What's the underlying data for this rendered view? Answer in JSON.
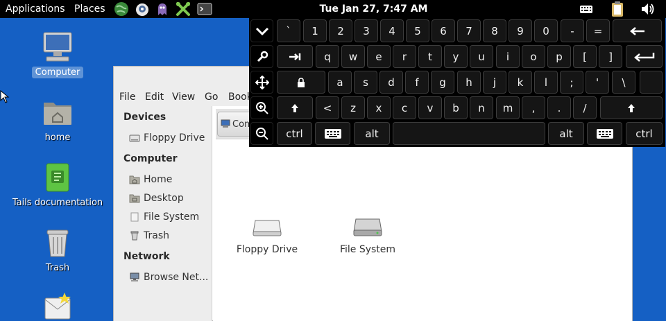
{
  "top_panel": {
    "applications": "Applications",
    "places": "Places",
    "clock": "Tue Jan 27,  7:47 AM"
  },
  "desktop": {
    "icons": [
      {
        "label": "Computer",
        "icon": "computer-icon"
      },
      {
        "label": "home",
        "icon": "home-folder-icon"
      },
      {
        "label": "Tails documentation",
        "icon": "documentation-icon"
      },
      {
        "label": "Trash",
        "icon": "trash-icon"
      },
      {
        "label": "",
        "icon": "mail-icon"
      }
    ]
  },
  "file_manager": {
    "menu": [
      "File",
      "Edit",
      "View",
      "Go",
      "Book"
    ],
    "sidebar": {
      "devices_heading": "Devices",
      "devices": [
        "Floppy Drive"
      ],
      "computer_heading": "Computer",
      "computer": [
        "Home",
        "Desktop",
        "File System",
        "Trash"
      ],
      "network_heading": "Network",
      "network": [
        "Browse Net..."
      ]
    },
    "location_button": "Com",
    "items": [
      "Floppy Drive",
      "File System"
    ]
  },
  "keyboard": {
    "rows": [
      [
        "collapse",
        "`",
        "1",
        "2",
        "3",
        "4",
        "5",
        "6",
        "7",
        "8",
        "9",
        "0",
        "-",
        "=",
        "backspace"
      ],
      [
        "settings",
        "tab",
        "q",
        "w",
        "e",
        "r",
        "t",
        "y",
        "u",
        "i",
        "o",
        "p",
        "[",
        "]",
        "enter"
      ],
      [
        "move",
        "caps-lock",
        "a",
        "s",
        "d",
        "f",
        "g",
        "h",
        "j",
        "k",
        "l",
        ";",
        "'",
        "\\"
      ],
      [
        "zoom-in",
        "shift",
        "<",
        "z",
        "x",
        "c",
        "v",
        "b",
        "n",
        "m",
        ",",
        ".",
        "/",
        "shift"
      ],
      [
        "zoom-out",
        "ctrl",
        "keyboard",
        "alt",
        "space",
        "alt",
        "keyboard",
        "ctrl"
      ]
    ]
  },
  "colors": {
    "desktop_background": "#1560c4",
    "panel": "#000000",
    "keyboard_background": "#000000",
    "key_face": "#151515",
    "selection": "#5f93d6"
  }
}
